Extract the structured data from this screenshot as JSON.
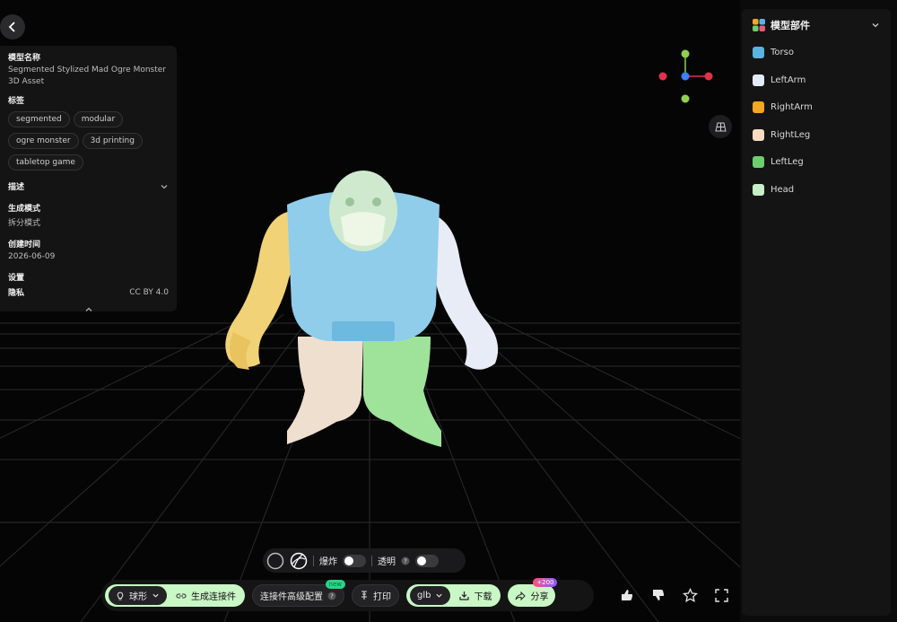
{
  "info": {
    "model_name_label": "模型名称",
    "model_name": "Segmented Stylized Mad Ogre Monster",
    "asset_type": "3D Asset",
    "tags_label": "标签",
    "tags": [
      "segmented",
      "modular",
      "ogre monster",
      "3d printing",
      "tabletop game"
    ],
    "description_label": "描述",
    "gen_mode_label": "生成模式",
    "gen_mode": "拆分模式",
    "created_label": "创建时间",
    "created": "2026-06-09",
    "settings_label": "设置",
    "privacy_label": "隐私",
    "license": "CC BY 4.0"
  },
  "parts_panel": {
    "title": "模型部件",
    "parts": [
      {
        "name": "Torso",
        "color": "#5bb3e0"
      },
      {
        "name": "LeftArm",
        "color": "#e4ebf8"
      },
      {
        "name": "RightArm",
        "color": "#f5a623"
      },
      {
        "name": "RightLeg",
        "color": "#f7dcc0"
      },
      {
        "name": "LeftLeg",
        "color": "#6ccf6c"
      },
      {
        "name": "Head",
        "color": "#c6efc8"
      }
    ]
  },
  "view_toolbar": {
    "explode_label": "爆炸",
    "transparent_label": "透明"
  },
  "bottom_bar": {
    "shape_label": "球形",
    "generate_label": "生成连接件",
    "advanced_label": "连接件高级配置",
    "new_badge": "new",
    "print_label": "打印",
    "format_label": "glb",
    "download_label": "下载",
    "share_label": "分享",
    "share_badge": "+200"
  },
  "colors": {
    "accent_green": "#c9f7c6",
    "panel_bg": "#141415",
    "axis_red": "#e0334a",
    "axis_green": "#8fd14f",
    "axis_blue": "#3b82f6"
  }
}
